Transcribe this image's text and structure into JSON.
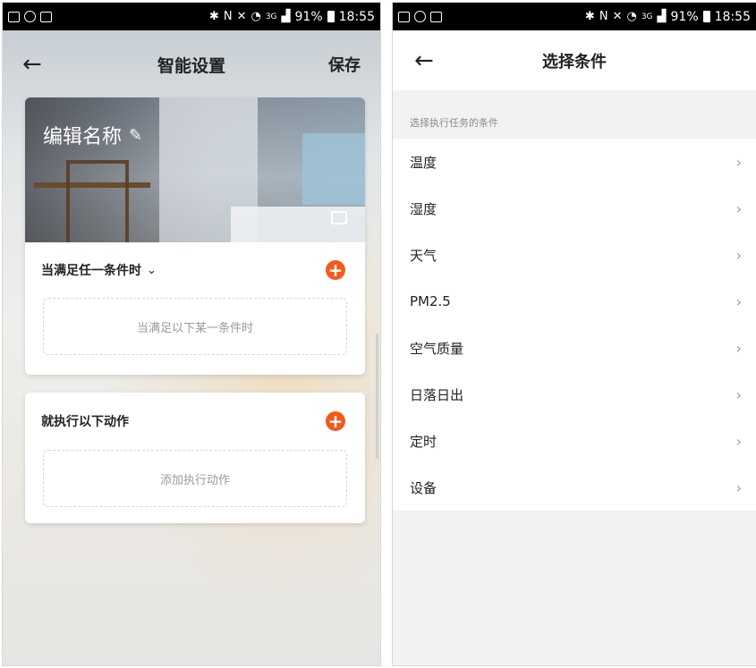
{
  "status_bar": {
    "left": {
      "time": "18:55",
      "battery": "91%",
      "network": "3G"
    },
    "right": {
      "time": "18:55",
      "battery": "91%",
      "network": "3G"
    }
  },
  "left_screen": {
    "title": "智能设置",
    "save_label": "保存",
    "scene_name": "编辑名称",
    "condition_section": {
      "label": "当满足任一条件时",
      "placeholder": "当满足以下某一条件时"
    },
    "action_section": {
      "label": "就执行以下动作",
      "placeholder": "添加执行动作"
    },
    "accent_color": "#f25a1d"
  },
  "right_screen": {
    "title": "选择条件",
    "section_label": "选择执行任务的条件",
    "conditions": [
      {
        "label": "温度"
      },
      {
        "label": "湿度"
      },
      {
        "label": "天气"
      },
      {
        "label": "PM2.5"
      },
      {
        "label": "空气质量"
      },
      {
        "label": "日落日出"
      },
      {
        "label": "定时"
      },
      {
        "label": "设备"
      }
    ]
  }
}
